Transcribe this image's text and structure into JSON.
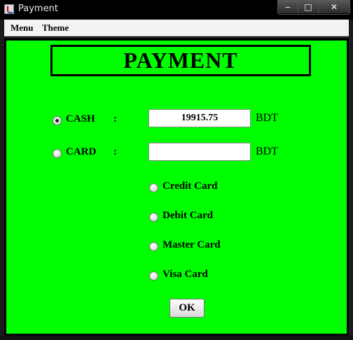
{
  "window": {
    "title": "Payment"
  },
  "title_buttons": {
    "minimize": "‒",
    "maximize": "□",
    "close": "✕"
  },
  "menu": {
    "items": [
      "Menu",
      "Theme"
    ]
  },
  "header": {
    "title": "PAYMENT"
  },
  "cash": {
    "label": "CASH",
    "colon": ":",
    "value": "19915.75",
    "unit": "BDT",
    "selected": true
  },
  "card": {
    "label": "CARD",
    "colon": ":",
    "value": "",
    "unit": "BDT",
    "selected": false
  },
  "card_types": [
    "Credit Card",
    "Debit Card",
    "Master Card",
    "Visa Card"
  ],
  "ok_button": {
    "label": "OK"
  },
  "colors": {
    "background": "#00ff00",
    "titlebar": "#000000"
  }
}
